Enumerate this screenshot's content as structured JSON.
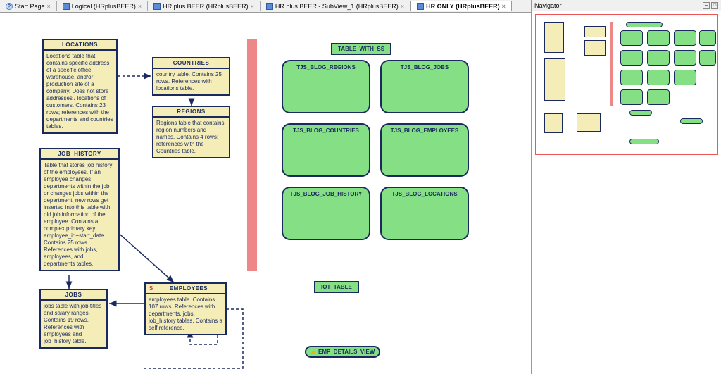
{
  "tabs": [
    {
      "label": "Start Page",
      "help": true
    },
    {
      "label": "Logical (HRplusBEER)"
    },
    {
      "label": "HR plus BEER (HRplusBEER)"
    },
    {
      "label": "HR plus BEER - SubView_1 (HRplusBEER)"
    },
    {
      "label": "HR ONLY (HRplusBEER)",
      "active": true
    }
  ],
  "navigator": {
    "title": "Navigator"
  },
  "entities": {
    "locations": {
      "title": "LOCATIONS",
      "body": "Locations table that contains specific address of a specific office, warehouse, and/or production site of a company. Does not store addresses / locations of customers. Contains 23 rows; references with the departments and countries tables."
    },
    "countries": {
      "title": "COUNTRIES",
      "body": "country table. Contains 25 rows. References with locations table."
    },
    "regions": {
      "title": "REGIONS",
      "body": "Regions table that contains region numbers and names. Contains 4 rows; references with the Countries table."
    },
    "job_history": {
      "title": "JOB_HISTORY",
      "body": "Table that stores job history of the employees. If an employee changes departments within the job or changes jobs within the department, new rows get inserted into this table with old job information of the employee. Contains a complex primary key: employee_id+start_date. Contains 25 rows. References with jobs, employees, and departments tables."
    },
    "jobs": {
      "title": "JOBS",
      "body": "jobs table with job titles and salary ranges. Contains 19 rows. References with employees and job_history table."
    },
    "employees": {
      "title_prefix": "S",
      "title": "EMPLOYEES",
      "body": "employees table. Contains 107 rows. References with departments, jobs, job_history tables. Contains a self reference."
    }
  },
  "section_titles": {
    "table_with_ss": "TABLE_WITH_SS",
    "iot_table": "IOT_TABLE",
    "emp_details_view": "EMP_DETAILS_VIEW"
  },
  "green_boxes": {
    "tjs_blog_regions": "TJS_BLOG_REGIONS",
    "tjs_blog_jobs": "TJS_BLOG_JOBS",
    "tjs_blog_countries": "TJS_BLOG_COUNTRIES",
    "tjs_blog_employees": "TJS_BLOG_EMPLOYEES",
    "tjs_blog_job_history": "TJS_BLOG_JOB_HISTORY",
    "tjs_blog_locations": "TJS_BLOG_LOCATIONS"
  }
}
